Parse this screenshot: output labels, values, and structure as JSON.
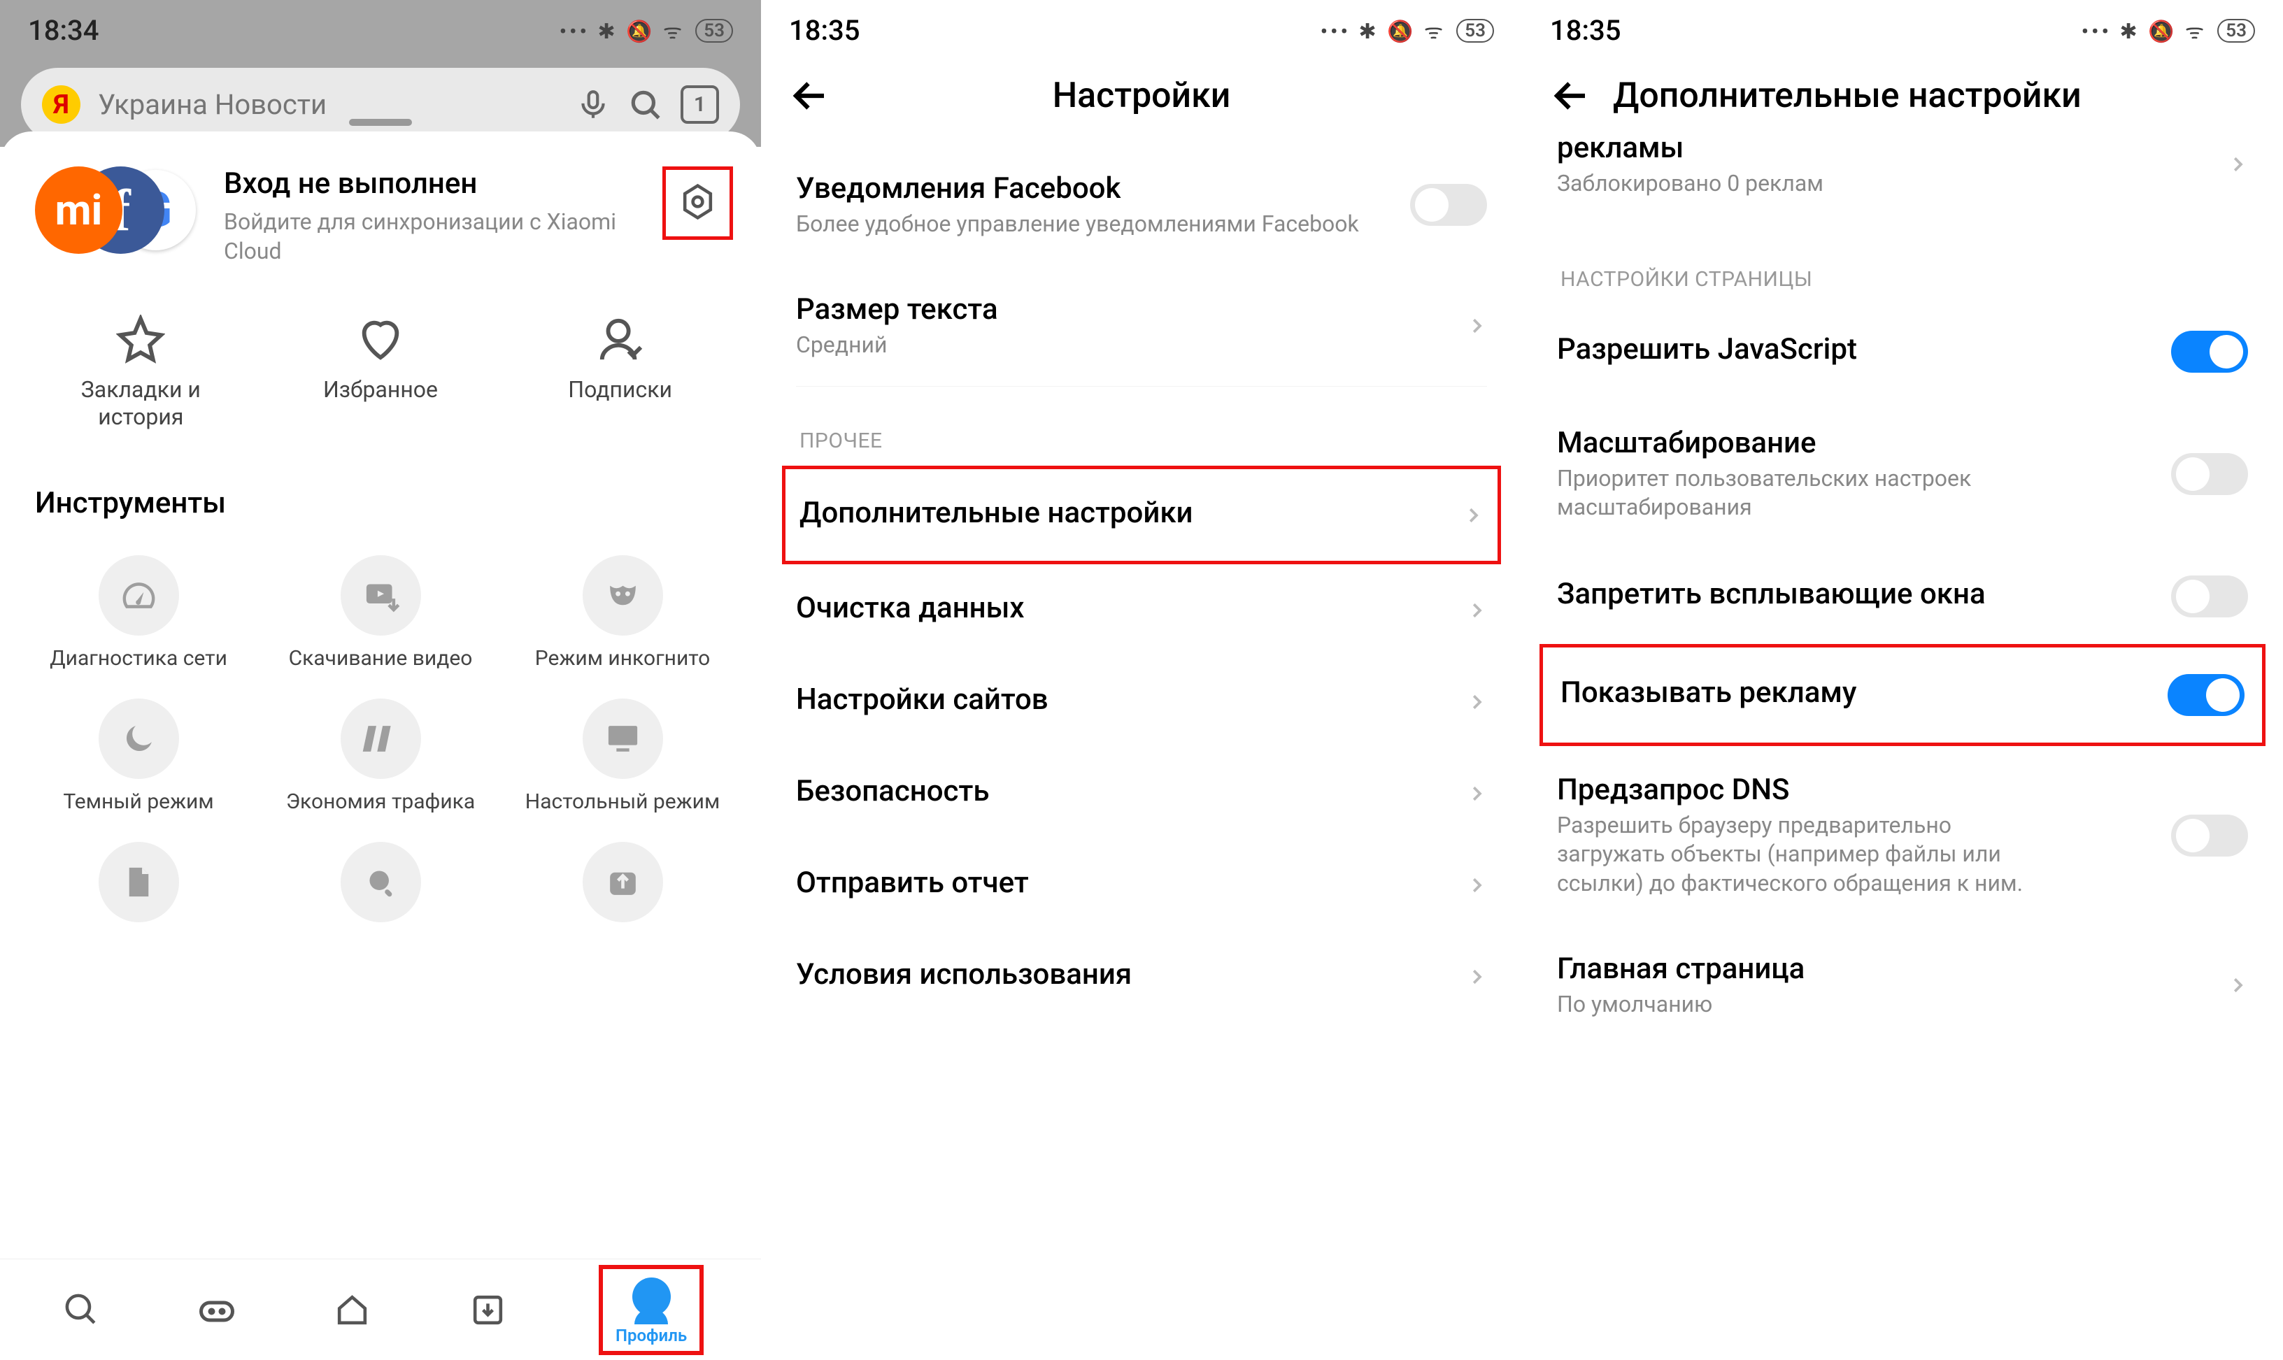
{
  "status": {
    "time1": "18:34",
    "time2": "18:35",
    "time3": "18:35",
    "battery": "53"
  },
  "screen1": {
    "search_placeholder": "Украина Новости",
    "tab_count": "1",
    "login_title": "Вход не выполнен",
    "login_sub": "Войдите для синхронизации с Xiaomi Cloud",
    "row3": {
      "bookmarks": "Закладки и история",
      "favorites": "Избранное",
      "subs": "Подписки"
    },
    "tools_title": "Инструменты",
    "tools": {
      "diag": "Диагностика сети",
      "download": "Скачивание видео",
      "incognito": "Режим инкогнито",
      "dark": "Темный режим",
      "saver": "Экономия трафика",
      "desktop": "Настольный режим"
    },
    "profile_label": "Профиль"
  },
  "screen2": {
    "title": "Настройки",
    "fb_title": "Уведомления Facebook",
    "fb_sub": "Более удобное управление уведомлениями Facebook",
    "textsize_title": "Размер текста",
    "textsize_value": "Средний",
    "section_other": "ПРОЧЕЕ",
    "advanced": "Дополнительные настройки",
    "clear": "Очистка данных",
    "sites": "Настройки сайтов",
    "security": "Безопасность",
    "report": "Отправить отчет",
    "terms": "Условия использования"
  },
  "screen3": {
    "title": "Дополнительные настройки",
    "adblock_title": "рекламы",
    "adblock_sub": "Заблокировано 0 реклам",
    "section_page": "НАСТРОЙКИ СТРАНИЦЫ",
    "js_title": "Разрешить JavaScript",
    "zoom_title": "Масштабирование",
    "zoom_sub": "Приоритет пользовательских настроек масштабирования",
    "popup_title": "Запретить всплывающие окна",
    "ads_title": "Показывать рекламу",
    "dns_title": "Предзапрос DNS",
    "dns_sub": "Разрешить браузеру предварительно загружать объекты (например файлы или ссылки) до фактического обращения к ним.",
    "home_title": "Главная страница",
    "home_sub": "По умолчанию"
  }
}
